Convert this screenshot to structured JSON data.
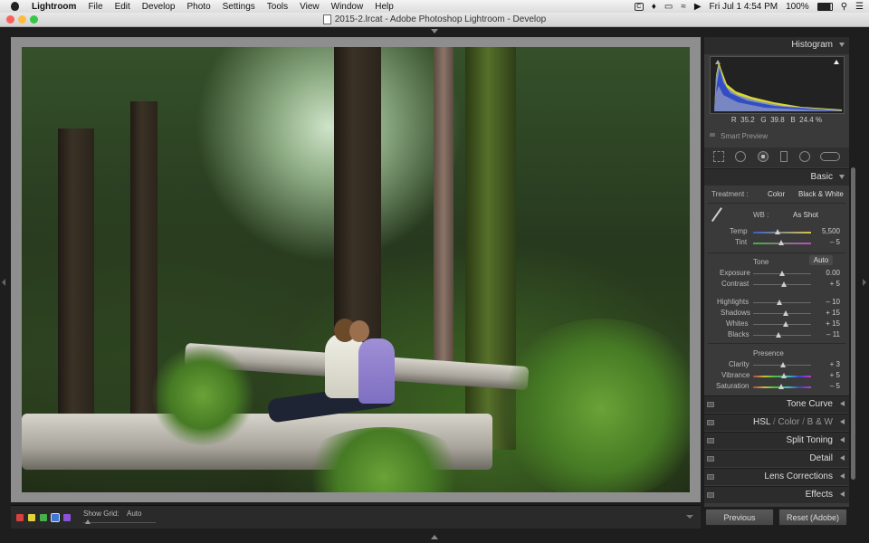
{
  "menubar": {
    "app_name": "Lightroom",
    "menus": [
      "File",
      "Edit",
      "Develop",
      "Photo",
      "Settings",
      "Tools",
      "View",
      "Window",
      "Help"
    ],
    "clock": "Fri Jul 1  4:54 PM",
    "battery": "100%",
    "tray_c": "C"
  },
  "window": {
    "title": "2015-2.lrcat - Adobe Photoshop Lightroom - Develop"
  },
  "toolbar": {
    "show_grid_label": "Show Grid:",
    "show_grid_value": "Auto"
  },
  "panel": {
    "histogram_label": "Histogram",
    "readout": {
      "r_label": "R",
      "r_value": "35.2",
      "g_label": "G",
      "g_value": "39.8",
      "b_label": "B",
      "b_value": "24.4",
      "unit": "%"
    },
    "smart_preview": "Smart Preview",
    "basic_label": "Basic",
    "treatment_label": "Treatment :",
    "treatment_color": "Color",
    "treatment_bw": "Black & White",
    "wb_label": "WB :",
    "wb_value": "As Shot",
    "temp_label": "Temp",
    "temp_value": "5,500",
    "tint_label": "Tint",
    "tint_value": "– 5",
    "tone_label": "Tone",
    "auto_label": "Auto",
    "exposure_label": "Exposure",
    "exposure_value": "0.00",
    "contrast_label": "Contrast",
    "contrast_value": "+ 5",
    "highlights_label": "Highlights",
    "highlights_value": "– 10",
    "shadows_label": "Shadows",
    "shadows_value": "+ 15",
    "whites_label": "Whites",
    "whites_value": "+ 15",
    "blacks_label": "Blacks",
    "blacks_value": "– 11",
    "presence_label": "Presence",
    "clarity_label": "Clarity",
    "clarity_value": "+ 3",
    "vibrance_label": "Vibrance",
    "vibrance_value": "+ 5",
    "saturation_label": "Saturation",
    "saturation_value": "– 5",
    "tone_curve_label": "Tone Curve",
    "hsl_label": "HSL",
    "hsl_sep": "/",
    "color_label": "Color",
    "bw_label": "B & W",
    "split_toning_label": "Split Toning",
    "detail_label": "Detail",
    "lens_corrections_label": "Lens Corrections",
    "effects_label": "Effects"
  },
  "buttons": {
    "previous": "Previous",
    "reset": "Reset (Adobe)"
  },
  "sliders": {
    "temp": 0.42,
    "tint": 0.49,
    "exposure": 0.5,
    "contrast": 0.53,
    "highlights": 0.45,
    "shadows": 0.57,
    "whites": 0.57,
    "blacks": 0.44,
    "clarity": 0.52,
    "vibrance": 0.53,
    "saturation": 0.48
  },
  "colors": {
    "accent_red": "#d64040",
    "accent_yellow": "#e0d23a",
    "accent_green": "#46b04a",
    "accent_blue": "#3f78d8",
    "accent_purple": "#8b52d8"
  }
}
